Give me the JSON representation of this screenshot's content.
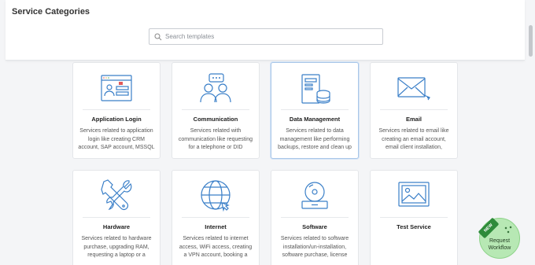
{
  "header": {
    "title": "Service Categories",
    "search_placeholder": "Search templates"
  },
  "cards": [
    {
      "title": "Application Login",
      "description": "Services related to application login like creating CRM account, SAP account, MSSQL",
      "icon": "app-login-icon"
    },
    {
      "title": "Communication",
      "description": "Services related with communication like requesting for a telephone or DID",
      "icon": "communication-icon"
    },
    {
      "title": "Data Management",
      "description": "Services related to data management like performing backups, restore and clean up",
      "icon": "data-management-icon",
      "selected": true
    },
    {
      "title": "Email",
      "description": "Services related to email like creating an email account, email client installation,",
      "icon": "email-icon"
    },
    {
      "title": "Hardware",
      "description": "Services related to hardware purchase, upgrading RAM, requesting a laptop or a",
      "icon": "hardware-icon"
    },
    {
      "title": "Internet",
      "description": "Services related to internet access, WiFi access, creating a VPN account, booking a",
      "icon": "internet-icon"
    },
    {
      "title": "Software",
      "description": "Services related to software installation/un-installation, software purchase, license",
      "icon": "software-icon"
    },
    {
      "title": "Test Service",
      "description": "",
      "icon": "image-placeholder-icon"
    }
  ],
  "fab": {
    "badge": "NEW",
    "label_line1": "Request",
    "label_line2": "Workflow"
  },
  "colors": {
    "icon_stroke": "#3a7fc8",
    "fab_bg": "#b7e8b4",
    "badge_bg": "#2e8b3a"
  }
}
